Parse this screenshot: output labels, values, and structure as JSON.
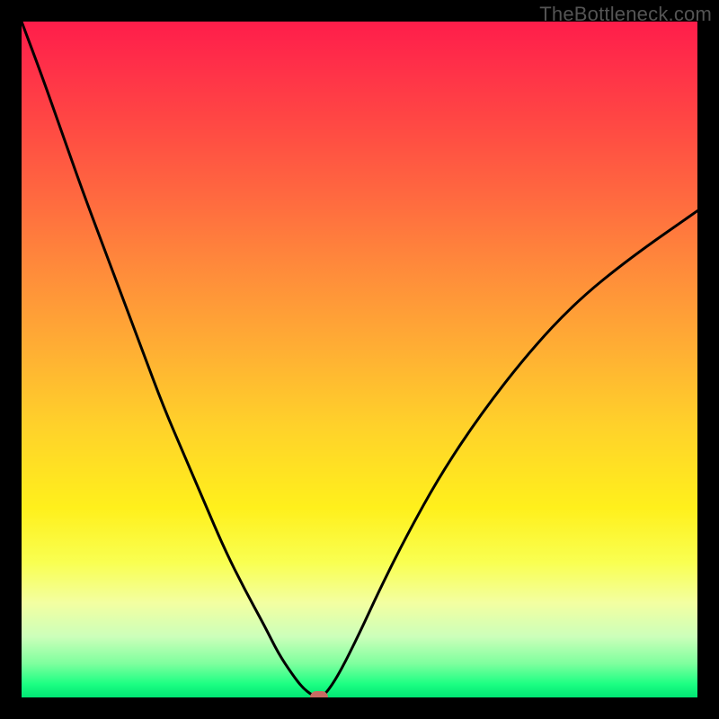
{
  "watermark": "TheBottleneck.com",
  "colors": {
    "frame": "#000000",
    "curve_stroke": "#000000",
    "marker_fill": "#c76b63",
    "watermark_text": "#545454"
  },
  "chart_data": {
    "type": "line",
    "title": "",
    "xlabel": "",
    "ylabel": "",
    "xlim": [
      0,
      100
    ],
    "ylim": [
      0,
      100
    ],
    "x": [
      0,
      3,
      6,
      9,
      12,
      15,
      18,
      21,
      24,
      27,
      30,
      33,
      36,
      38,
      40,
      41.5,
      43,
      44,
      45,
      47,
      50,
      53,
      57,
      62,
      68,
      75,
      82,
      90,
      100
    ],
    "values": [
      100,
      92,
      83.5,
      75,
      67,
      59,
      51,
      43,
      36,
      29,
      22,
      16,
      10.5,
      6.5,
      3.5,
      1.5,
      0.3,
      0,
      0.5,
      3.5,
      9.5,
      16,
      24,
      33,
      42,
      51,
      58.5,
      65,
      72
    ],
    "marker": {
      "x": 44,
      "y": 0
    },
    "grid": false,
    "legend": false
  }
}
